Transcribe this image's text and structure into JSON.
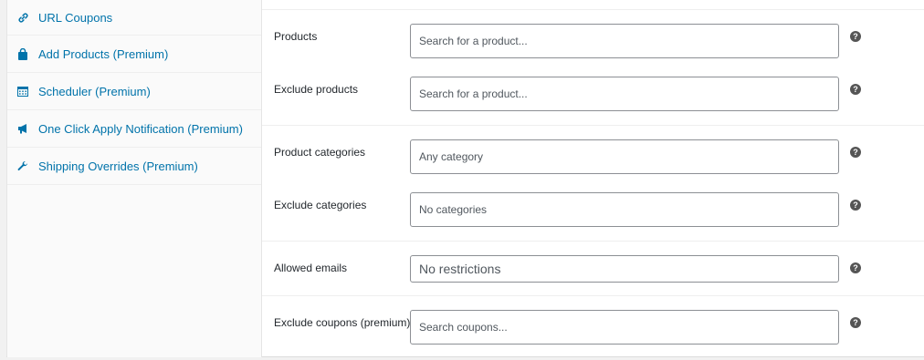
{
  "sidebar": {
    "items": [
      {
        "label": "URL Coupons",
        "icon": "link-icon"
      },
      {
        "label": "Add Products (Premium)",
        "icon": "bag-icon"
      },
      {
        "label": "Scheduler (Premium)",
        "icon": "calendar-icon"
      },
      {
        "label": "One Click Apply Notification (Premium)",
        "icon": "megaphone-icon"
      },
      {
        "label": "Shipping Overrides (Premium)",
        "icon": "wrench-icon"
      }
    ]
  },
  "fields": {
    "products": {
      "label": "Products",
      "placeholder": "Search for a product..."
    },
    "exclude_products": {
      "label": "Exclude products",
      "placeholder": "Search for a product..."
    },
    "product_categories": {
      "label": "Product categories",
      "placeholder": "Any category"
    },
    "exclude_categories": {
      "label": "Exclude categories",
      "placeholder": "No categories"
    },
    "allowed_emails": {
      "label": "Allowed emails",
      "placeholder": "No restrictions"
    },
    "exclude_coupons": {
      "label": "Exclude coupons (premium)",
      "placeholder": "Search coupons..."
    }
  },
  "help_symbol": "?",
  "colors": {
    "link": "#0073aa",
    "help_bg": "#555555"
  }
}
